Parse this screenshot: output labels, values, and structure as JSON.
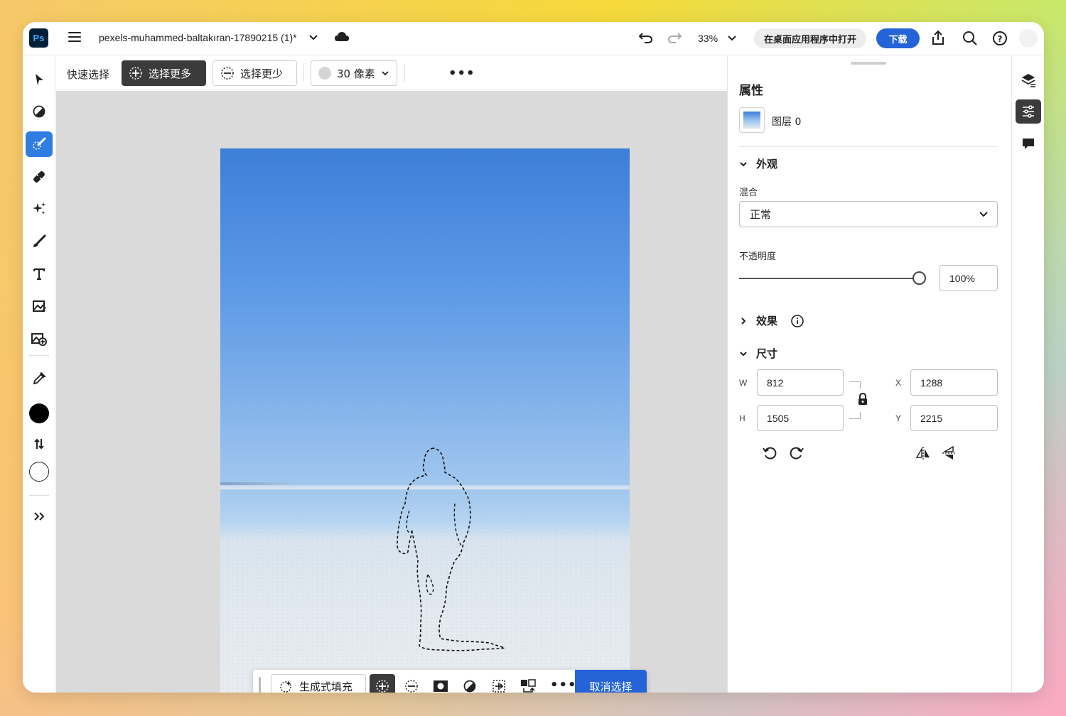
{
  "app": {
    "logo_text": "Ps",
    "doc_title": "pexels-muhammed-baltakıran-17890215 (1)*",
    "zoom": "33%",
    "open_in_desktop": "在桌面应用程序中打开",
    "download": "下载"
  },
  "options_bar": {
    "tool_name": "快速选择",
    "add_to_selection": "选择更多",
    "subtract_from_selection": "选择更少",
    "brush_size": "30 像素"
  },
  "context_bar": {
    "generative_fill": "生成式填充",
    "deselect": "取消选择"
  },
  "properties": {
    "title": "属性",
    "layer_name": "图层 0",
    "appearance": {
      "title": "外观",
      "blend_label": "混合",
      "blend_value": "正常",
      "opacity_label": "不透明度",
      "opacity_value": "100%",
      "opacity_fraction": 1.0
    },
    "effects": {
      "title": "效果"
    },
    "dimensions": {
      "title": "尺寸",
      "w_label": "W",
      "w_value": "812",
      "h_label": "H",
      "h_value": "1505",
      "x_label": "X",
      "x_value": "1288",
      "y_label": "Y",
      "y_value": "2215"
    }
  },
  "icons": {
    "left_tools": [
      "select-arrow-icon",
      "adjust-icon",
      "quick-select-icon",
      "healing-icon",
      "generative-icon",
      "brush-icon",
      "type-icon",
      "place-image-icon",
      "add-image-icon",
      "eyedropper-icon",
      "foreground-color-icon",
      "swap-colors-icon",
      "background-color-icon",
      "more-tools-icon"
    ],
    "right_strip": [
      "layers-icon",
      "properties-icon",
      "comments-icon"
    ]
  },
  "colors": {
    "accent": "#2463d8",
    "active_tool": "#2f7de1",
    "foreground": "#000000",
    "background": "#ffffff"
  }
}
